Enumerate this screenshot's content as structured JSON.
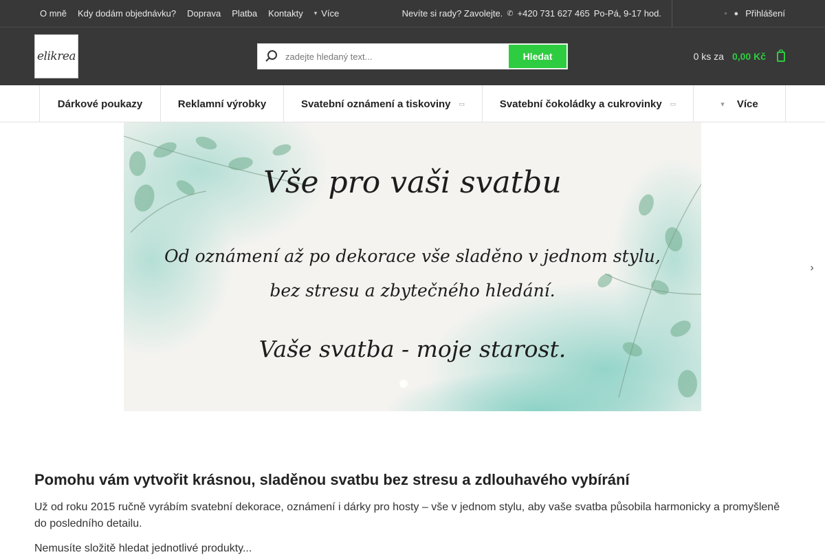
{
  "topbar": {
    "links": [
      "O mně",
      "Kdy dodám objednávku?",
      "Doprava",
      "Platba",
      "Kontakty"
    ],
    "more_label": "Více",
    "contact_text": "Nevíte si rady? Zavolejte.",
    "phone": "+420 731 627 465",
    "hours": "Po-Pá, 9-17 hod.",
    "login_label": "Přihlášení"
  },
  "header": {
    "logo_text": "elikrea",
    "search_placeholder": "zadejte hledaný text...",
    "search_button": "Hledat",
    "cart_count": "0 ks za",
    "cart_total": "0,00 Kč"
  },
  "nav": {
    "items": [
      {
        "label": "Dárkové poukazy"
      },
      {
        "label": "Reklamní výrobky"
      },
      {
        "label": "Svatební oznámení a tiskoviny"
      },
      {
        "label": "Svatební čokoládky a cukrovinky"
      },
      {
        "label": "Více"
      }
    ]
  },
  "banner": {
    "line1": "Vše pro vaši svatbu",
    "line2": "Od oznámení až po dekorace vše sladěno v jednom stylu,",
    "line3": "bez stresu a zbytečného hledání.",
    "line4": "Vaše svatba - moje starost."
  },
  "content": {
    "heading": "Pomohu vám vytvořit krásnou, sladěnou svatbu bez stresu a zdlouhavého vybírání",
    "paragraph": "Už od roku 2015 ručně vyrábím svatební dekorace, oznámení i dárky pro hosty – vše v jednom stylu, aby vaše svatba působila harmonicky a promyšleně do posledního detailu.",
    "paragraph2": "Nemusíte složitě hledat jednotlivé produkty..."
  },
  "colors": {
    "dark_bg": "#383838",
    "accent_green": "#2ecc40"
  }
}
